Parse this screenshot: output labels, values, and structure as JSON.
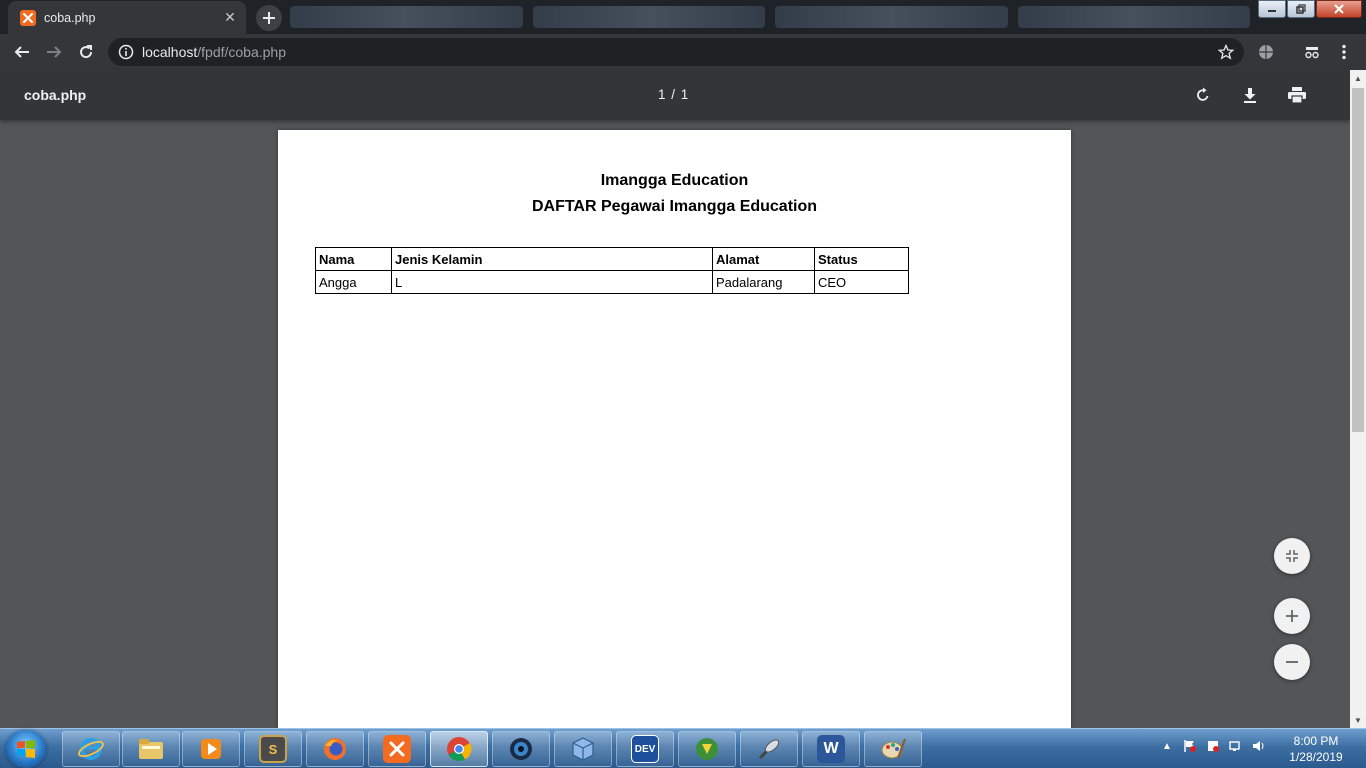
{
  "browser": {
    "tab_title": "coba.php",
    "url_host": "localhost",
    "url_path": "/fpdf/coba.php"
  },
  "pdf_viewer": {
    "file_name": "coba.php",
    "page_indicator": "1 / 1"
  },
  "document": {
    "title": "Imangga Education",
    "subtitle": "DAFTAR Pegawai Imangga Education",
    "table": {
      "headers": [
        "Nama",
        "Jenis Kelamin",
        "Alamat",
        "Status"
      ],
      "rows": [
        [
          "Angga",
          "L",
          "Padalarang",
          "CEO"
        ]
      ]
    }
  },
  "taskbar": {
    "apps": [
      {
        "icon": "internet-explorer-icon"
      },
      {
        "icon": "file-explorer-icon"
      },
      {
        "icon": "media-player-icon"
      },
      {
        "icon": "sublime-text-icon",
        "label": "S"
      },
      {
        "icon": "firefox-icon"
      },
      {
        "icon": "xampp-icon"
      },
      {
        "icon": "chrome-icon"
      },
      {
        "icon": "camera-app-icon"
      },
      {
        "icon": "virtualbox-icon"
      },
      {
        "icon": "dev-cpp-icon",
        "label": "DEV"
      },
      {
        "icon": "internet-download-manager-icon"
      },
      {
        "icon": "satellite-app-icon"
      },
      {
        "icon": "word-icon",
        "label": "W"
      },
      {
        "icon": "paint-icon"
      }
    ],
    "clock_time": "8:00 PM",
    "clock_date": "1/28/2019"
  },
  "colors": {
    "viewer_background": "#525659",
    "toolbar": "#35363a",
    "pdf_header": "#323639",
    "xampp_orange": "#f26b21"
  }
}
